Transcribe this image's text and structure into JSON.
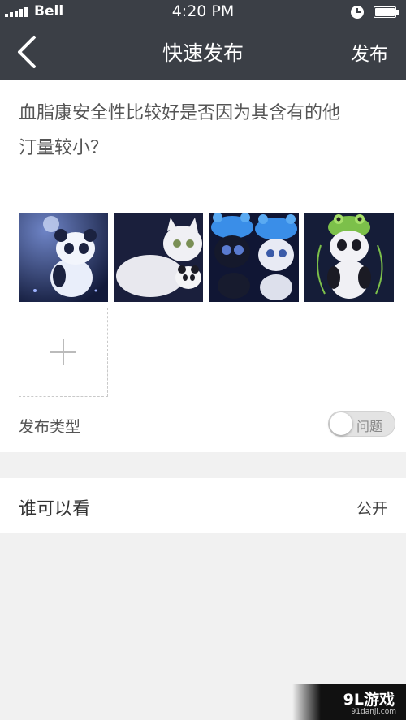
{
  "status_bar": {
    "carrier": "Bell",
    "time": "4:20 PM",
    "signal_icon": "signal-bars-icon",
    "alarm_icon": "alarm-clock-icon",
    "battery_icon": "battery-icon"
  },
  "nav": {
    "back_icon": "chevron-left-icon",
    "title": "快速发布",
    "publish_label": "发布",
    "background_color": "#3b3f46"
  },
  "post": {
    "question_line1": "血脂康安全性比较好是否因为其含有的他",
    "question_line2": "汀量较小？",
    "photos": [
      "panda-photo",
      "white-cat-with-panda-photo",
      "two-cats-blue-hats-photo",
      "panda-frog-hat-photo"
    ],
    "add_photo_icon": "plus-icon"
  },
  "publish_type": {
    "label": "发布类型",
    "toggle_text": "问题"
  },
  "visibility": {
    "label": "谁可以看",
    "value": "公开"
  },
  "watermark": {
    "logo": "9L游戏",
    "url": "91danji.com"
  }
}
